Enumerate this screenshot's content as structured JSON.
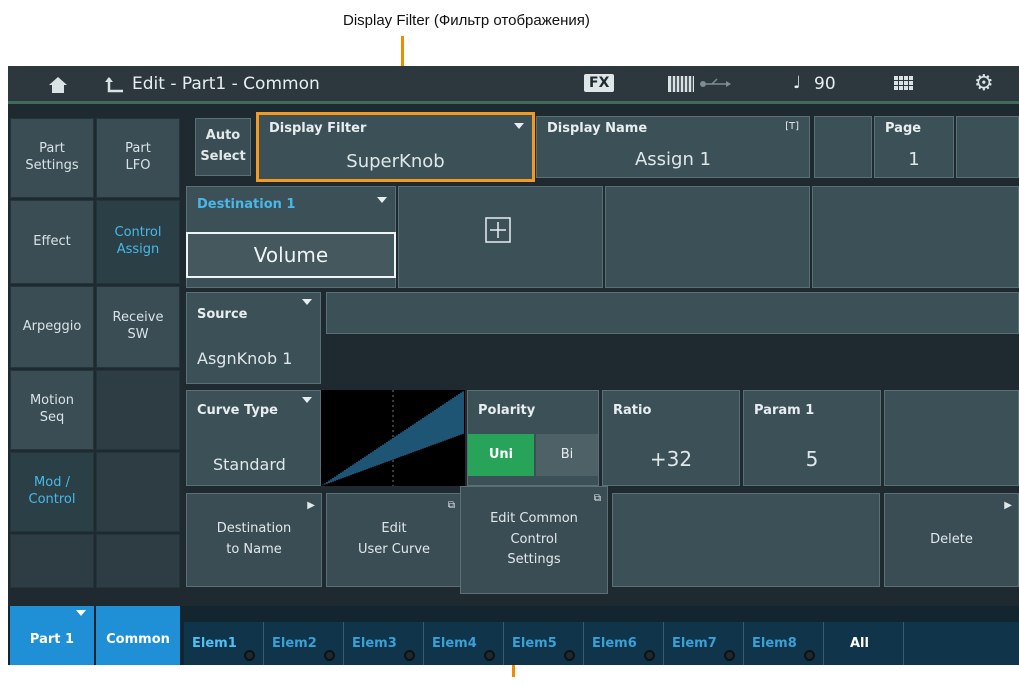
{
  "callouts": {
    "top": "Display Filter (Фильтр отображения)"
  },
  "titlebar": {
    "home_icon": "home-icon",
    "back_icon": "back-arrow-icon",
    "title": "Edit - Part1 - Common",
    "fx": "FX",
    "keyboard_icon": "keyboard-icon",
    "usb_icon": "usb-icon",
    "note_icon": "quarter-note-icon",
    "tempo": "90",
    "grid_icon": "grid-icon",
    "gear_icon": "gear-icon"
  },
  "left_tabs": {
    "part_settings": [
      "Part",
      "Settings"
    ],
    "part_lfo": [
      "Part",
      "LFO"
    ],
    "effect": "Effect",
    "control_assign": [
      "Control",
      "Assign"
    ],
    "arpeggio": "Arpeggio",
    "receive_sw": [
      "Receive",
      "SW"
    ],
    "motion_seq": [
      "Motion",
      "Seq"
    ],
    "mod_control": [
      "Mod /",
      "Control"
    ]
  },
  "header": {
    "auto_select": [
      "Auto",
      "Select"
    ],
    "display_filter_label": "Display Filter",
    "display_filter_value": "SuperKnob",
    "display_name_label": "Display Name",
    "display_name_badge": "[T]",
    "display_name_value": "Assign 1",
    "page_label": "Page",
    "page_value": "1"
  },
  "destination": {
    "label": "Destination 1",
    "value": "Volume",
    "add_icon": "plus-icon"
  },
  "source": {
    "label": "Source",
    "value": "AsgnKnob 1"
  },
  "curve": {
    "label": "Curve Type",
    "value": "Standard",
    "polarity_label": "Polarity",
    "polarity_uni": "Uni",
    "polarity_bi": "Bi",
    "polarity_selected": "Uni",
    "ratio_label": "Ratio",
    "ratio_value": "+32",
    "param1_label": "Param 1",
    "param1_value": "5"
  },
  "actions": {
    "dest_to_name": [
      "Destination",
      "to Name"
    ],
    "edit_user_curve": [
      "Edit",
      "User Curve"
    ],
    "edit_common": [
      "Edit Common",
      "Control",
      "Settings"
    ],
    "delete": "Delete"
  },
  "bottom": {
    "part": "Part 1",
    "common": "Common",
    "elements": [
      "Elem1",
      "Elem2",
      "Elem3",
      "Elem4",
      "Elem5",
      "Elem6",
      "Elem7",
      "Elem8"
    ],
    "all": "All"
  },
  "colors": {
    "accent_blue": "#1f8fd6",
    "highlight_orange": "#f39a20",
    "uni_green": "#27a35a"
  }
}
